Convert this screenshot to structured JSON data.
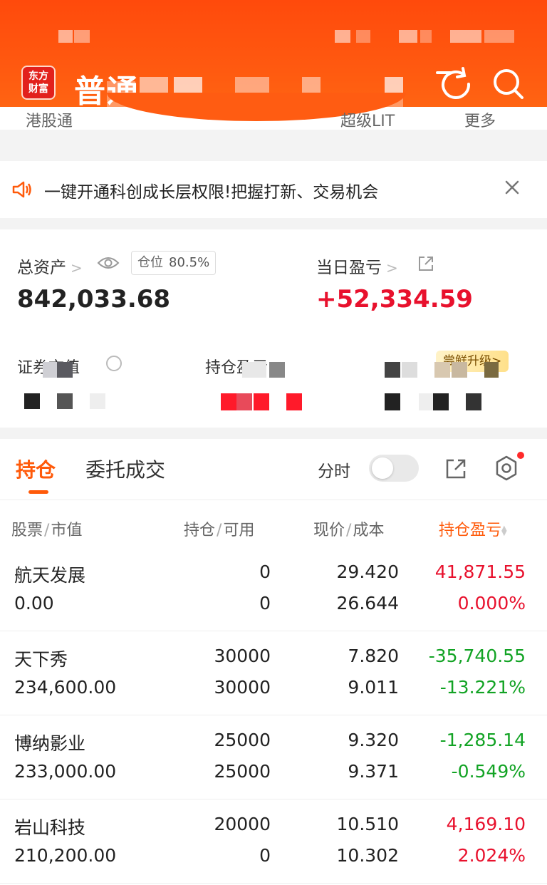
{
  "header": {
    "logo_line1": "东方",
    "logo_line2": "财富",
    "account_title": "普通",
    "subtabs": [
      "港股通",
      "超级LIT",
      "更多"
    ]
  },
  "notice": {
    "text": "一键开通科创成长层权限!把握打新、交易机会"
  },
  "assets": {
    "total_label": "总资产",
    "position_label": "仓位",
    "position_value": "80.5%",
    "total_value": "842,033.68",
    "daily_pl_label": "当日盈亏",
    "daily_pl_value": "+52,334.59",
    "market_value_label": "证券市值",
    "holding_pl_label": "持仓盈亏",
    "upgrade_label": "尝鲜升级>"
  },
  "tabs": {
    "holdings": "持仓",
    "orders": "委托成交",
    "fenshi": "分时"
  },
  "table": {
    "headers": {
      "stock": "股票",
      "market_value": "市值",
      "holding": "持仓",
      "available": "可用",
      "price": "现价",
      "cost": "成本",
      "pl": "持仓盈亏"
    },
    "rows": [
      {
        "name": "航天发展",
        "mv": "0.00",
        "hold": "0",
        "avail": "0",
        "price": "29.420",
        "cost": "26.644",
        "pl": "41,871.55",
        "plpct": "0.000%",
        "trend": "up"
      },
      {
        "name": "天下秀",
        "mv": "234,600.00",
        "hold": "30000",
        "avail": "30000",
        "price": "7.820",
        "cost": "9.011",
        "pl": "-35,740.55",
        "plpct": "-13.221%",
        "trend": "down"
      },
      {
        "name": "博纳影业",
        "mv": "233,000.00",
        "hold": "25000",
        "avail": "25000",
        "price": "9.320",
        "cost": "9.371",
        "pl": "-1,285.14",
        "plpct": "-0.549%",
        "trend": "down"
      },
      {
        "name": "岩山科技",
        "mv": "210,200.00",
        "hold": "20000",
        "avail": "0",
        "price": "10.510",
        "cost": "10.302",
        "pl": "4,169.10",
        "plpct": "2.024%",
        "trend": "up"
      }
    ]
  },
  "colors": {
    "brand": "#ff5a0a",
    "up": "#e8112d",
    "down": "#12a324"
  }
}
